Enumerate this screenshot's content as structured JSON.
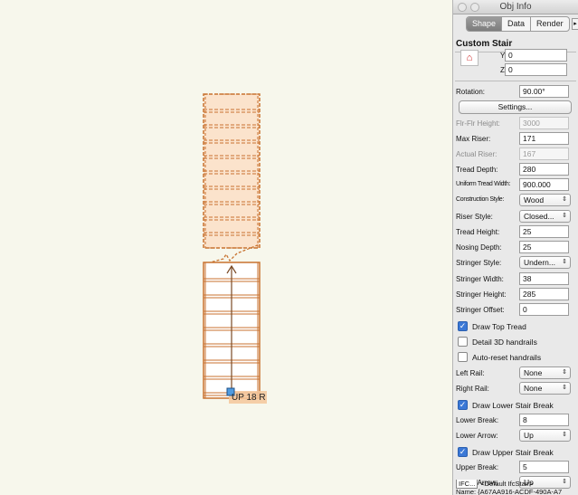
{
  "window": {
    "title": "Obj Info"
  },
  "tabs": [
    {
      "label": "Shape"
    },
    {
      "label": "Data"
    },
    {
      "label": "Render"
    }
  ],
  "object_type": "Custom Stair",
  "fields": {
    "y_label": "Y:",
    "y_value": "0",
    "z_label": "Z:",
    "z_value": "0",
    "rotation_label": "Rotation:",
    "rotation_value": "90.00°",
    "settings_button": "Settings...",
    "flr_flr_height_label": "Flr-Flr Height:",
    "flr_flr_height_value": "3000",
    "max_riser_label": "Max Riser:",
    "max_riser_value": "171",
    "actual_riser_label": "Actual Riser:",
    "actual_riser_value": "167",
    "tread_depth_label": "Tread Depth:",
    "tread_depth_value": "280",
    "uniform_tread_width_label": "Uniform Tread Width:",
    "uniform_tread_width_value": "900.000",
    "construction_style_label": "Construction Style:",
    "construction_style_value": "Wood",
    "riser_style_label": "Riser Style:",
    "riser_style_value": "Closed...",
    "tread_height_label": "Tread Height:",
    "tread_height_value": "25",
    "nosing_depth_label": "Nosing Depth:",
    "nosing_depth_value": "25",
    "stringer_style_label": "Stringer Style:",
    "stringer_style_value": "Undern...",
    "stringer_width_label": "Stringer Width:",
    "stringer_width_value": "38",
    "stringer_height_label": "Stringer Height:",
    "stringer_height_value": "285",
    "stringer_offset_label": "Stringer Offset:",
    "stringer_offset_value": "0",
    "draw_top_tread_label": "Draw Top Tread",
    "detail_3d_handrails_label": "Detail 3D handrails",
    "auto_reset_handrails_label": "Auto-reset handrails",
    "left_rail_label": "Left Rail:",
    "left_rail_value": "None",
    "right_rail_label": "Right Rail:",
    "right_rail_value": "None",
    "draw_lower_stair_break_label": "Draw Lower Stair Break",
    "lower_break_label": "Lower Break:",
    "lower_break_value": "8",
    "lower_arrow_label": "Lower Arrow:",
    "lower_arrow_value": "Up",
    "draw_upper_stair_break_label": "Draw Upper Stair Break",
    "upper_break_label": "Upper Break:",
    "upper_break_value": "5",
    "upper_arrow_label": "Upper Arrow:",
    "upper_arrow_value": "Up"
  },
  "checkboxes": {
    "draw_top_tread": true,
    "detail_3d_handrails": false,
    "auto_reset_handrails": false,
    "draw_lower_stair_break": true,
    "draw_upper_stair_break": true
  },
  "footer": {
    "ifc_button": "IFC...",
    "ifc_class": "<Default IfcStair>",
    "name_line": "Name: {A67AA916-ACDF-490A-A7"
  },
  "drawing": {
    "stair_label": "UP 18 R",
    "stair_color": "#c8722f",
    "upper_fill": "#fbe3cc"
  }
}
